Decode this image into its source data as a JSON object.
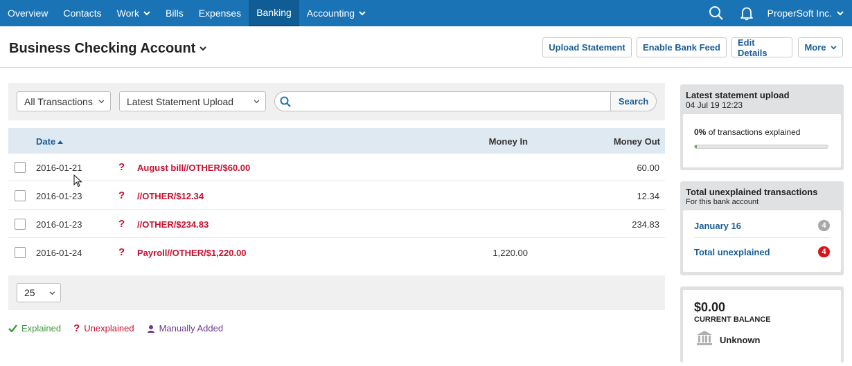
{
  "nav": {
    "items": [
      {
        "label": "Overview",
        "dropdown": false,
        "active": false
      },
      {
        "label": "Contacts",
        "dropdown": false,
        "active": false
      },
      {
        "label": "Work",
        "dropdown": true,
        "active": false
      },
      {
        "label": "Bills",
        "dropdown": false,
        "active": false
      },
      {
        "label": "Expenses",
        "dropdown": false,
        "active": false
      },
      {
        "label": "Banking",
        "dropdown": false,
        "active": true
      },
      {
        "label": "Accounting",
        "dropdown": true,
        "active": false
      }
    ],
    "org_name": "ProperSoft Inc.",
    "search_icon": "search-icon",
    "notifications_icon": "bell-icon"
  },
  "header": {
    "title": "Business Checking Account",
    "buttons": {
      "upload": "Upload Statement",
      "bank_feed": "Enable Bank Feed",
      "edit": "Edit Details",
      "more": "More"
    }
  },
  "filters": {
    "type_select": "All Transactions",
    "period_select": "Latest Statement Upload",
    "search_value": "",
    "search_button": "Search"
  },
  "table": {
    "columns": {
      "date": "Date",
      "money_in": "Money In",
      "money_out": "Money Out"
    },
    "rows": [
      {
        "date": "2016-01-21",
        "status": "?",
        "description": "August bill//OTHER/$60.00",
        "money_in": "",
        "money_out": "60.00"
      },
      {
        "date": "2016-01-23",
        "status": "?",
        "description": "//OTHER/$12.34",
        "money_in": "",
        "money_out": "12.34"
      },
      {
        "date": "2016-01-23",
        "status": "?",
        "description": "//OTHER/$234.83",
        "money_in": "",
        "money_out": "234.83"
      },
      {
        "date": "2016-01-24",
        "status": "?",
        "description": "Payroll//OTHER/$1,220.00",
        "money_in": "1,220.00",
        "money_out": ""
      }
    ]
  },
  "pagination": {
    "page_size": "25"
  },
  "legend": {
    "explained": "Explained",
    "unexplained": "Unexplained",
    "manual": "Manually Added"
  },
  "statement_panel": {
    "title": "Latest statement upload",
    "timestamp": "04 Jul 19 12:23",
    "percent": "0%",
    "percent_text": "of transactions explained",
    "progress_fraction": 0.0
  },
  "unexplained_panel": {
    "title": "Total unexplained transactions",
    "subtitle": "For this bank account",
    "rows": [
      {
        "label": "January 16",
        "count": "4",
        "badge_color": "#a8a8a8"
      },
      {
        "label": "Total unexplained",
        "count": "4",
        "badge_color": "#d9141c"
      }
    ]
  },
  "balance_panel": {
    "amount": "$0.00",
    "label": "CURRENT BALANCE",
    "bank": "Unknown"
  },
  "colors": {
    "nav_bg": "#1a73b5",
    "link": "#1a5e96",
    "unexplained": "#c8102e",
    "explained": "#3c9a3c",
    "manual": "#6b3a8e"
  }
}
